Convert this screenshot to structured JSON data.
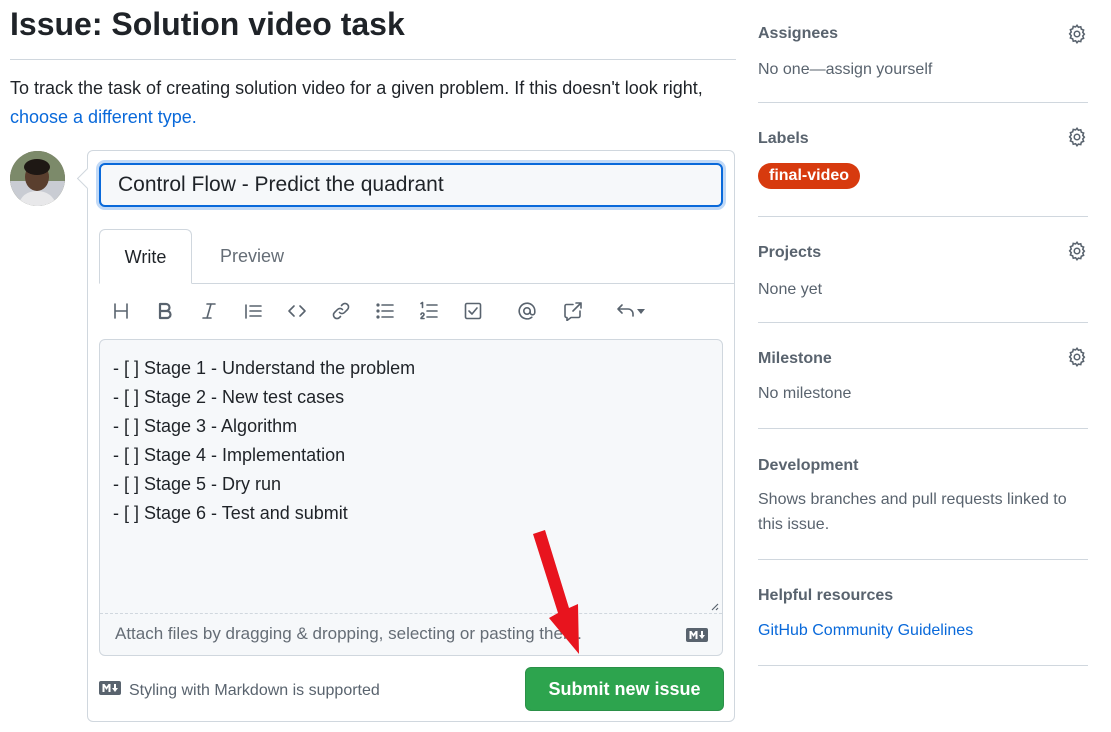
{
  "page": {
    "title": "Issue: Solution video task",
    "description_text": "To track the task of creating solution video for a given problem. If this doesn't look right,",
    "description_link": "choose a different type."
  },
  "form": {
    "title_value": "Control Flow - Predict the quadrant",
    "tabs": [
      {
        "label": "Write",
        "active": true
      },
      {
        "label": "Preview",
        "active": false
      }
    ],
    "toolbar_icons": [
      "heading-icon",
      "bold-icon",
      "italic-icon",
      "quote-icon",
      "code-icon",
      "link-icon",
      "unordered-list-icon",
      "ordered-list-icon",
      "task-list-icon",
      "mention-icon",
      "reference-icon",
      "undo-icon"
    ],
    "body_value": "- [ ] Stage 1 - Understand the problem\n- [ ] Stage 2 - New test cases\n- [ ] Stage 3 - Algorithm\n- [ ] Stage 4 - Implementation\n- [ ] Stage 5 - Dry run\n- [ ] Stage 6 - Test and submit",
    "attach_text": "Attach files by dragging & dropping, selecting or pasting them.",
    "markdown_note": "Styling with Markdown is supported",
    "submit_label": "Submit new issue",
    "submit_color": "#2da44e"
  },
  "sidebar": {
    "assignees": {
      "heading": "Assignees",
      "value": "No one—assign yourself"
    },
    "labels": {
      "heading": "Labels",
      "items": [
        {
          "name": "final-video",
          "color": "#d73a0e"
        }
      ]
    },
    "projects": {
      "heading": "Projects",
      "value": "None yet"
    },
    "milestone": {
      "heading": "Milestone",
      "value": "No milestone"
    },
    "development": {
      "heading": "Development",
      "value": "Shows branches and pull requests linked to this issue."
    },
    "helpful": {
      "heading": "Helpful resources",
      "link": "GitHub Community Guidelines"
    }
  },
  "colors": {
    "accent": "#0969da",
    "annotation_arrow": "#e8141e"
  }
}
